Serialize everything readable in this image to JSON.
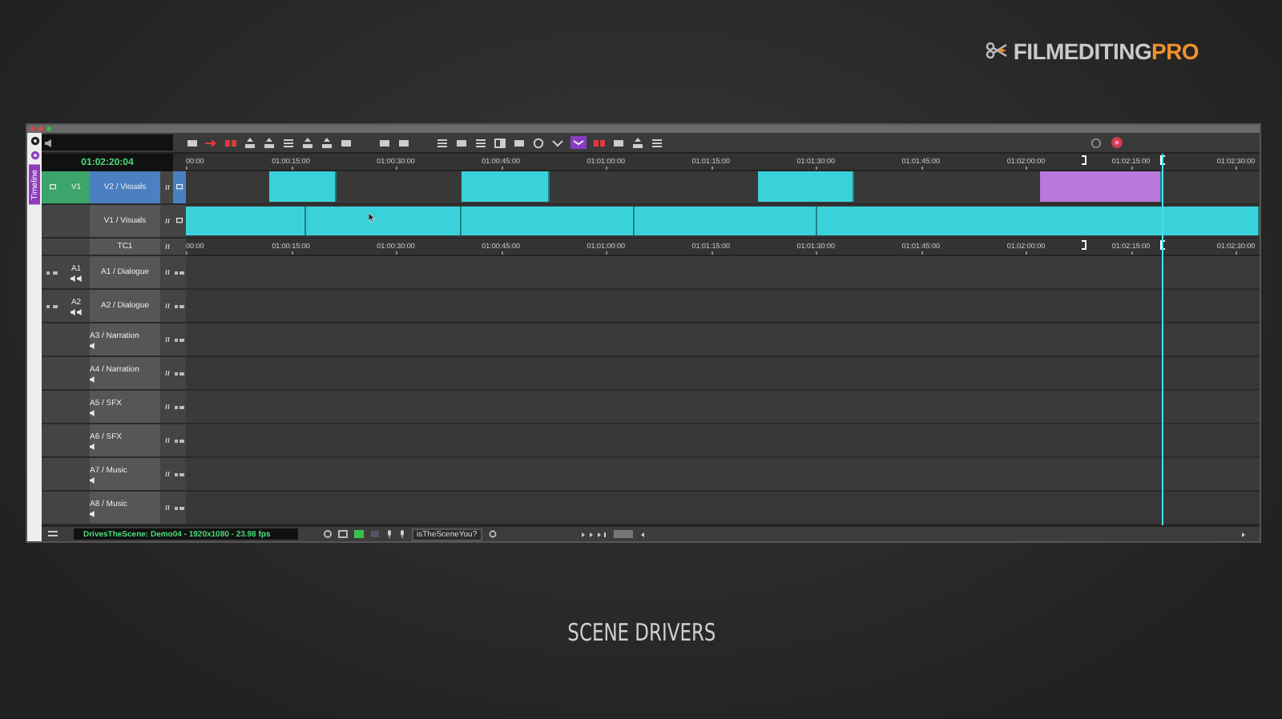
{
  "logo": {
    "text": "FILMEDITING",
    "accent": "PRO"
  },
  "window": {
    "side_tab": "Timeline",
    "timecode": "01:02:20:04"
  },
  "ruler": {
    "labels": [
      "00:00",
      "01:00:15:00",
      "01:00:30:00",
      "01:00:45:00",
      "01:01:00:00",
      "01:01:15:00",
      "01:01:30:00",
      "01:01:45:00",
      "01:02:00:00",
      "01:02:15:00",
      "01:02:30:00"
    ]
  },
  "tracks": [
    {
      "name": "V2 / Visuals",
      "kind": "video",
      "selected": true,
      "source": "V1",
      "clips": [
        {
          "color": "#3ad2da"
        },
        {
          "color": "#3ad2da"
        },
        {
          "color": "#3ad2da"
        },
        {
          "color": "#b878dc"
        }
      ]
    },
    {
      "name": "V1 / Visuals",
      "kind": "video",
      "selected": false,
      "clips": [
        {
          "color": "#3ad2da"
        },
        {
          "color": "#3ad2da"
        },
        {
          "color": "#3ad2da"
        },
        {
          "color": "#3ad2da"
        },
        {
          "color": "#3ad2da"
        }
      ]
    },
    {
      "name": "TC1",
      "kind": "timecode",
      "selected": false,
      "labels": [
        "00:00",
        "01:00:15:00",
        "01:00:30:00",
        "01:00:45:00",
        "01:01:00:00",
        "01:01:15:00",
        "01:01:30:00",
        "01:01:45:00",
        "01:02:00:00",
        "01:02:15:00",
        "01:02:30:00"
      ]
    },
    {
      "name": "A1 / Dialogue",
      "kind": "audio",
      "selected": false,
      "source": "A1"
    },
    {
      "name": "A2 / Dialogue",
      "kind": "audio",
      "selected": false,
      "source": "A2"
    },
    {
      "name": "A3 / Narration",
      "kind": "audio",
      "selected": false
    },
    {
      "name": "A4 / Narration",
      "kind": "audio",
      "selected": false
    },
    {
      "name": "A5 / SFX",
      "kind": "audio",
      "selected": false
    },
    {
      "name": "A6 / SFX",
      "kind": "audio",
      "selected": false
    },
    {
      "name": "A7 / Music",
      "kind": "audio",
      "selected": false
    },
    {
      "name": "A8 / Music",
      "kind": "audio",
      "selected": false
    }
  ],
  "status_bar": {
    "sequence": "DrivesTheScene: Demo04 - 1920x1080 - 23.98 fps",
    "search_value": "isTheSceneYou?"
  },
  "caption": "SCENE DRIVERS"
}
